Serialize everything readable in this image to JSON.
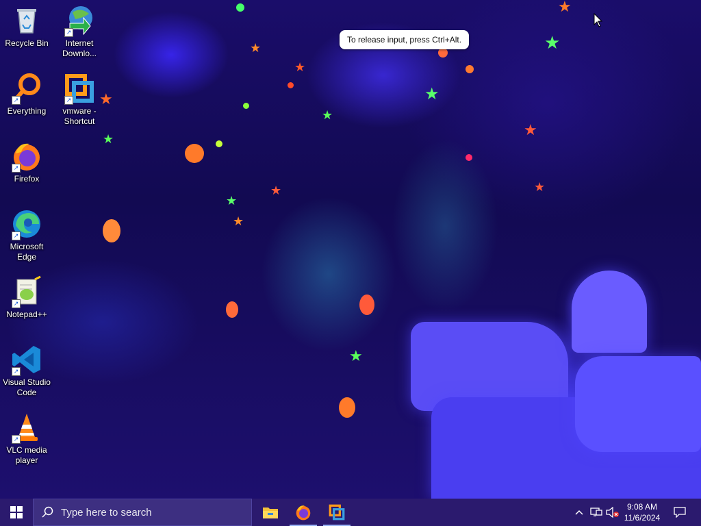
{
  "desktop": {
    "icons": [
      {
        "label": "Recycle Bin",
        "icon": "recycle-bin-icon",
        "shortcut": false
      },
      {
        "label": "Internet Downlo...",
        "icon": "internet-download-manager-icon",
        "shortcut": true
      },
      {
        "label": "Everything",
        "icon": "everything-search-icon",
        "shortcut": true
      },
      {
        "label": "vmware - Shortcut",
        "icon": "vmware-icon",
        "shortcut": true
      },
      {
        "label": "Firefox",
        "icon": "firefox-icon",
        "shortcut": true
      },
      {
        "label": "Microsoft Edge",
        "icon": "edge-icon",
        "shortcut": true
      },
      {
        "label": "Notepad++",
        "icon": "notepad-plus-plus-icon",
        "shortcut": true
      },
      {
        "label": "Visual Studio Code",
        "icon": "vscode-icon",
        "shortcut": true
      },
      {
        "label": "VLC media player",
        "icon": "vlc-icon",
        "shortcut": true
      }
    ],
    "tooltip": "To release input, press Ctrl+Alt."
  },
  "taskbar": {
    "search_placeholder": "Type here to search",
    "apps": [
      {
        "name": "File Explorer",
        "icon": "file-explorer-icon",
        "running": false
      },
      {
        "name": "Firefox",
        "icon": "firefox-icon",
        "running": true
      },
      {
        "name": "VMware",
        "icon": "vmware-icon",
        "running": true
      }
    ],
    "tray": {
      "icons": [
        "chevron-up-icon",
        "network-icon",
        "volume-muted-icon"
      ],
      "time": "9:08 AM",
      "date": "11/6/2024",
      "notification_icon": "notification-icon"
    }
  },
  "colors": {
    "taskbar": "#2b1a6e",
    "search_box": "#3d2f81",
    "wallpaper_base": "#120a52"
  }
}
